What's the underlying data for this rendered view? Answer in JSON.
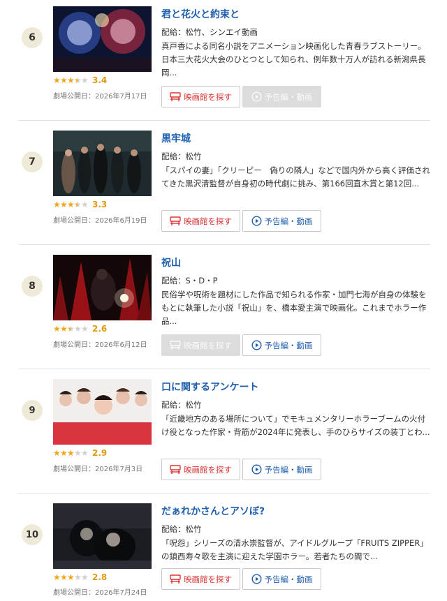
{
  "colors": {
    "title_link": "#1f5fae",
    "theater_button": "#d33333",
    "star_on": "#f2a51a",
    "star_off": "#cfcfcf",
    "rank_badge": "#efead7",
    "disabled_button": "#dcdcdc"
  },
  "icons": {
    "theater": "theater-seat-icon",
    "trailer": "play-circle-icon"
  },
  "movies": [
    {
      "rank": "6",
      "title": "君と花火と約束と",
      "distributor": "配給：松竹、シンエイ動画",
      "description": "真戸香による同名小説をアニメーション映画化した青春ラブストーリー。日本三大花火大会のひとつとして知られ、例年数十万人が訪れる新潟県長岡...",
      "rating": 3.4,
      "rating_text": "3.4",
      "release": "劇場公開日：2026年7月17日",
      "theater_label": "映画館を探す",
      "trailer_label": "予告編・動画",
      "theater_enabled": true,
      "trailer_enabled": false
    },
    {
      "rank": "7",
      "title": "黒牢城",
      "distributor": "配給：松竹",
      "description": "「スパイの妻」「クリーピー　偽りの隣人」などで国内外から高く評価されてきた黒沢清監督が自身初の時代劇に挑み、第166回直木賞と第12回...",
      "rating": 3.3,
      "rating_text": "3.3",
      "release": "劇場公開日：2026年6月19日",
      "theater_label": "映画館を探す",
      "trailer_label": "予告編・動画",
      "theater_enabled": true,
      "trailer_enabled": true
    },
    {
      "rank": "8",
      "title": "祝山",
      "distributor": "配給：S・D・P",
      "description": "民俗学や呪術を題材にした作品で知られる作家・加門七海が自身の体験をもとに執筆した小説「祝山」を、橋本愛主演で映画化。これまでホラー作品...",
      "rating": 2.6,
      "rating_text": "2.6",
      "release": "劇場公開日：2026年6月12日",
      "theater_label": "映画館を探す",
      "trailer_label": "予告編・動画",
      "theater_enabled": false,
      "trailer_enabled": true
    },
    {
      "rank": "9",
      "title": "口に関するアンケート",
      "distributor": "配給：松竹",
      "description": "「近畿地方のある場所について」でモキュメンタリーホラーブームの火付け役となった作家・背筋が2024年に発表し、手のひらサイズの装丁とわ...",
      "rating": 2.9,
      "rating_text": "2.9",
      "release": "劇場公開日：2026年7月3日",
      "theater_label": "映画館を探す",
      "trailer_label": "予告編・動画",
      "theater_enabled": true,
      "trailer_enabled": true
    },
    {
      "rank": "10",
      "title": "だぁれかさんとアソぼ?",
      "distributor": "配給：松竹",
      "description": "「呪怨」シリーズの清水崇監督が、アイドルグループ「FRUITS ZIPPER」の鎮西寿々歌を主演に迎えた学園ホラー。若者たちの間で...",
      "rating": 2.8,
      "rating_text": "2.8",
      "release": "劇場公開日：2026年7月24日",
      "theater_label": "映画館を探す",
      "trailer_label": "予告編・動画",
      "theater_enabled": true,
      "trailer_enabled": true
    }
  ]
}
